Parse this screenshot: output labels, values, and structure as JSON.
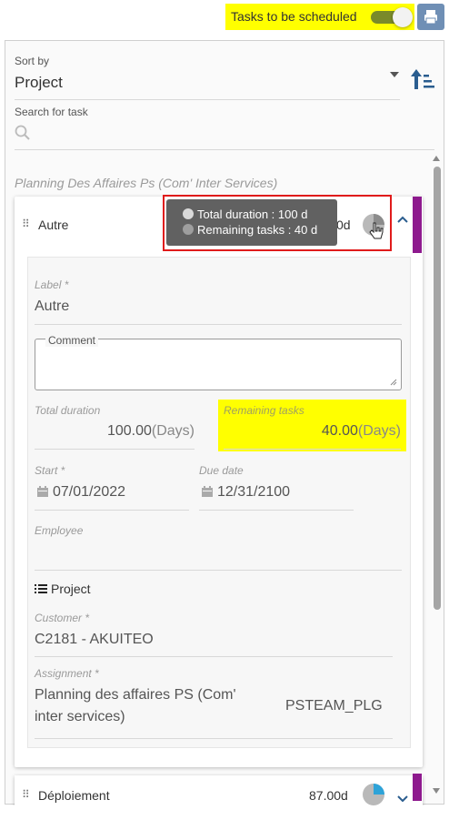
{
  "toolbar": {
    "toggle_label": "Tasks to be scheduled",
    "toggle_on": true,
    "print_icon": "print-icon"
  },
  "sort": {
    "label": "Sort by",
    "value": "Project"
  },
  "search": {
    "label": "Search for task",
    "placeholder": ""
  },
  "group": {
    "title": "Planning Des Affaires Ps (Com' Inter Services)"
  },
  "task1": {
    "name": "Autre",
    "duration_short": "0d",
    "tooltip_total": "Total duration : 100 d",
    "tooltip_remaining": "Remaining tasks : 40 d",
    "label_label": "Label *",
    "label_value": "Autre",
    "comment_label": "Comment",
    "comment_value": "",
    "total_duration_label": "Total duration",
    "total_duration_value": "100.00",
    "total_duration_unit": "(Days)",
    "remaining_label": "Remaining tasks",
    "remaining_value": "40.00",
    "remaining_unit": "(Days)",
    "start_label": "Start *",
    "start_value": "07/01/2022",
    "due_label": "Due date",
    "due_value": "12/31/2100",
    "employee_label": "Employee",
    "employee_value": "",
    "project_section": "Project",
    "customer_label": "Customer *",
    "customer_value": "C2181 - AKUITEO",
    "assignment_label": "Assignment *",
    "assignment_value_line1": "Planning des affaires PS (Com'",
    "assignment_value_line2": "inter services)",
    "assignment_code": "PSTEAM_PLG"
  },
  "task2": {
    "name": "Déploiement",
    "duration": "87.00d"
  },
  "colors": {
    "highlight": "#ffff00",
    "accent_purple": "#8e1a8e",
    "tooltip_bg": "#616161",
    "print_button": "#6f8fb5",
    "frame_red": "#e01b1b"
  }
}
